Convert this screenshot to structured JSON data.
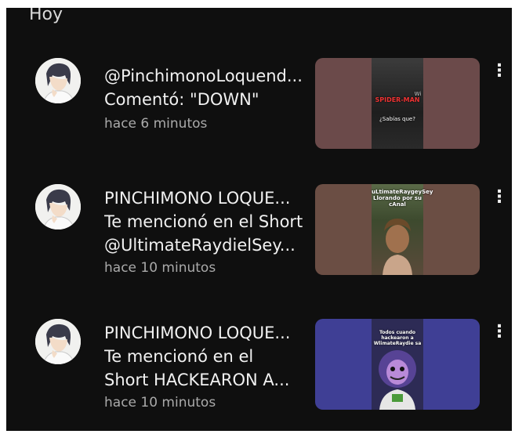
{
  "section": {
    "title": "Hoy"
  },
  "notifications": [
    {
      "lines": [
        "@PinchimonoLoquend...",
        "Comentó: \"DOWN\""
      ],
      "time": "hace 6 minutos",
      "thumb": {
        "bg": "#6b4a4a",
        "inner_bg": "#2a2a2a",
        "title": "SPIDER-MAN",
        "caption": "¿Sabías que?",
        "corner": "Wi"
      }
    },
    {
      "lines": [
        "PINCHIMONO LOQUE...",
        "Te mencionó en el Short",
        "@UltimateRaydielSey..."
      ],
      "time": "hace 10 minutos",
      "thumb": {
        "bg": "#6b4e44",
        "inner_bg": "#4a5a3a",
        "caption": "uLtimateRaygeySey Llorando por su cAnal"
      }
    },
    {
      "lines": [
        "PINCHIMONO LOQUE...",
        "Te mencionó en el",
        "Short HACKEARON A..."
      ],
      "time": "hace 10 minutos",
      "thumb": {
        "bg": "#3f3f95",
        "inner_bg": "#2d2b55",
        "caption": "Todos cuando hackearon a WlimateRaydie sa"
      }
    }
  ],
  "icons": {
    "menu": "more-vertical-icon",
    "avatar": "user-avatar-anime"
  }
}
